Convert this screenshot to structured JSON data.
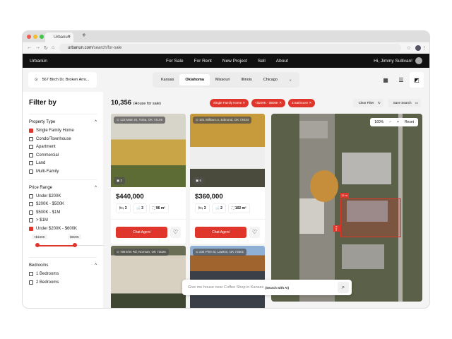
{
  "browser": {
    "tab_title": "Urbanun",
    "url_host": "urbanun.com",
    "url_path": "/search/for-sale"
  },
  "nav": {
    "logo": "Urbanün",
    "links": [
      "For Sale",
      "For Rent",
      "New Project",
      "Sell",
      "About"
    ],
    "greeting": "Hi, Jimmy Sullivan!"
  },
  "toolbar": {
    "location": "567 Birch Dr, Broken Arro...",
    "cities": [
      "Kansas",
      "Oklahoma",
      "Missouri",
      "Illinois",
      "Chicago"
    ],
    "active_city": "Oklahoma"
  },
  "sidebar": {
    "title": "Filter by",
    "property_type": {
      "label": "Property Type",
      "options": [
        {
          "label": "Single Family Home",
          "checked": true
        },
        {
          "label": "Condo/Townhouse",
          "checked": false
        },
        {
          "label": "Apartment",
          "checked": false
        },
        {
          "label": "Commercial",
          "checked": false
        },
        {
          "label": "Land",
          "checked": false
        },
        {
          "label": "Multi-Family",
          "checked": false
        }
      ]
    },
    "price_range": {
      "label": "Price Range",
      "options": [
        {
          "label": "Under $200K",
          "checked": false
        },
        {
          "label": "$200K - $500K",
          "checked": false
        },
        {
          "label": "$500K - $1M",
          "checked": false
        },
        {
          "label": "> $1M",
          "checked": false
        },
        {
          "label": "Under $200K - $600K",
          "checked": true
        }
      ],
      "slider_min": "<$100K",
      "slider_max": "$600K"
    },
    "bedrooms": {
      "label": "Bedrooms",
      "options": [
        {
          "label": "1 Bedrooms",
          "checked": false
        },
        {
          "label": "2 Bedrooms",
          "checked": false
        }
      ]
    }
  },
  "results": {
    "count": "10,356",
    "count_label": "(House for sale)",
    "chips": [
      "Single Family Home",
      "<$200K - $600K",
      "3 Bathroom"
    ],
    "clear_filter": "Clear Filter",
    "save_search": "Save Search"
  },
  "listings": [
    {
      "address": "123 Main St, Tulsa, OK 74106",
      "photos": "3",
      "price": "$440,000",
      "beds": "3",
      "baths": "3",
      "area": "96 m²",
      "cta": "Chat Agent",
      "color": "#b89a55"
    },
    {
      "address": "101 Willow Ln, Edmond, OK 73034",
      "photos": "6",
      "price": "$360,000",
      "beds": "3",
      "baths": "2",
      "area": "102 m²",
      "cta": "Chat Agent",
      "color": "#8a7a50"
    },
    {
      "address": "789 Elm Rd, Norman, OK 73026",
      "color": "#c9c2b2"
    },
    {
      "address": "234 Pine St, Lawton, OK 73501",
      "color": "#6b5a44"
    }
  ],
  "map": {
    "zoom": "160%",
    "reset": "Reset",
    "width_label": "12 m",
    "depth_label": "8 m"
  },
  "ai_search": {
    "placeholder": "Give me house near Coffee Shop in Kansas",
    "hint": "(Search with AI)"
  }
}
